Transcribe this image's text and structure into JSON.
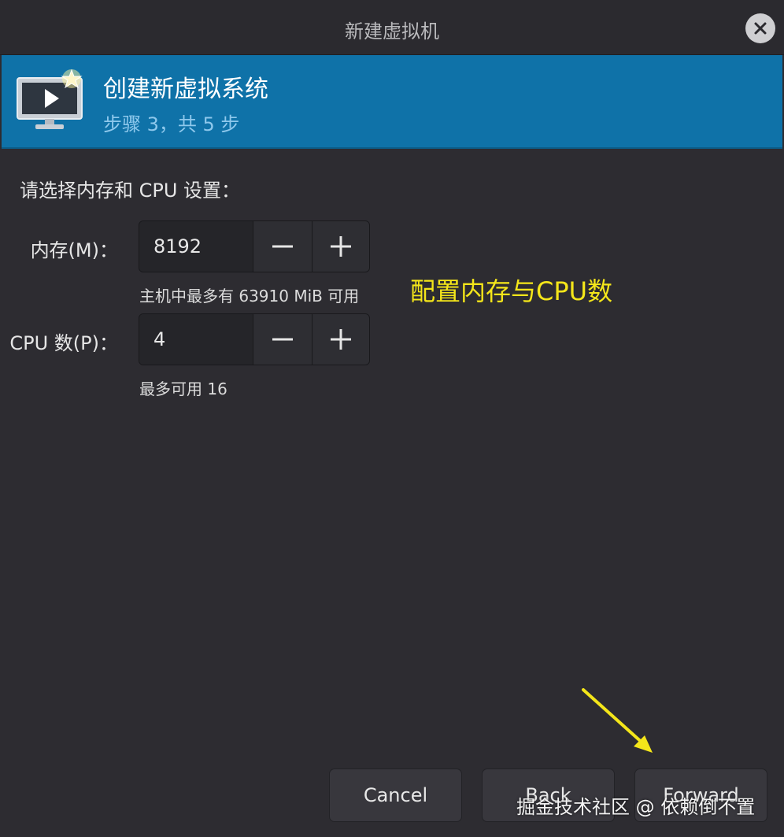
{
  "window": {
    "title": "新建虚拟机"
  },
  "banner": {
    "title": "创建新虚拟系统",
    "subtitle": "步骤 3，共 5 步"
  },
  "form": {
    "prompt": "请选择内存和 CPU 设置：",
    "memory": {
      "label": "内存(M)：",
      "value": "8192",
      "hint": "主机中最多有 63910 MiB 可用"
    },
    "cpu": {
      "label": "CPU 数(P)：",
      "value": "4",
      "hint": "最多可用 16"
    }
  },
  "annotation": {
    "text": "配置内存与CPU数",
    "color": "#f4e61a"
  },
  "footer": {
    "cancel": "Cancel",
    "back": "Back",
    "forward": "Forward"
  },
  "watermark": "掘金技术社区 @ 依赖倒不置",
  "colors": {
    "banner": "#0f72a8",
    "background": "#2d2c31"
  },
  "icons": {
    "banner": "monitor-play-star-icon",
    "close": "close-icon",
    "decrement": "minus-icon",
    "increment": "plus-icon"
  }
}
